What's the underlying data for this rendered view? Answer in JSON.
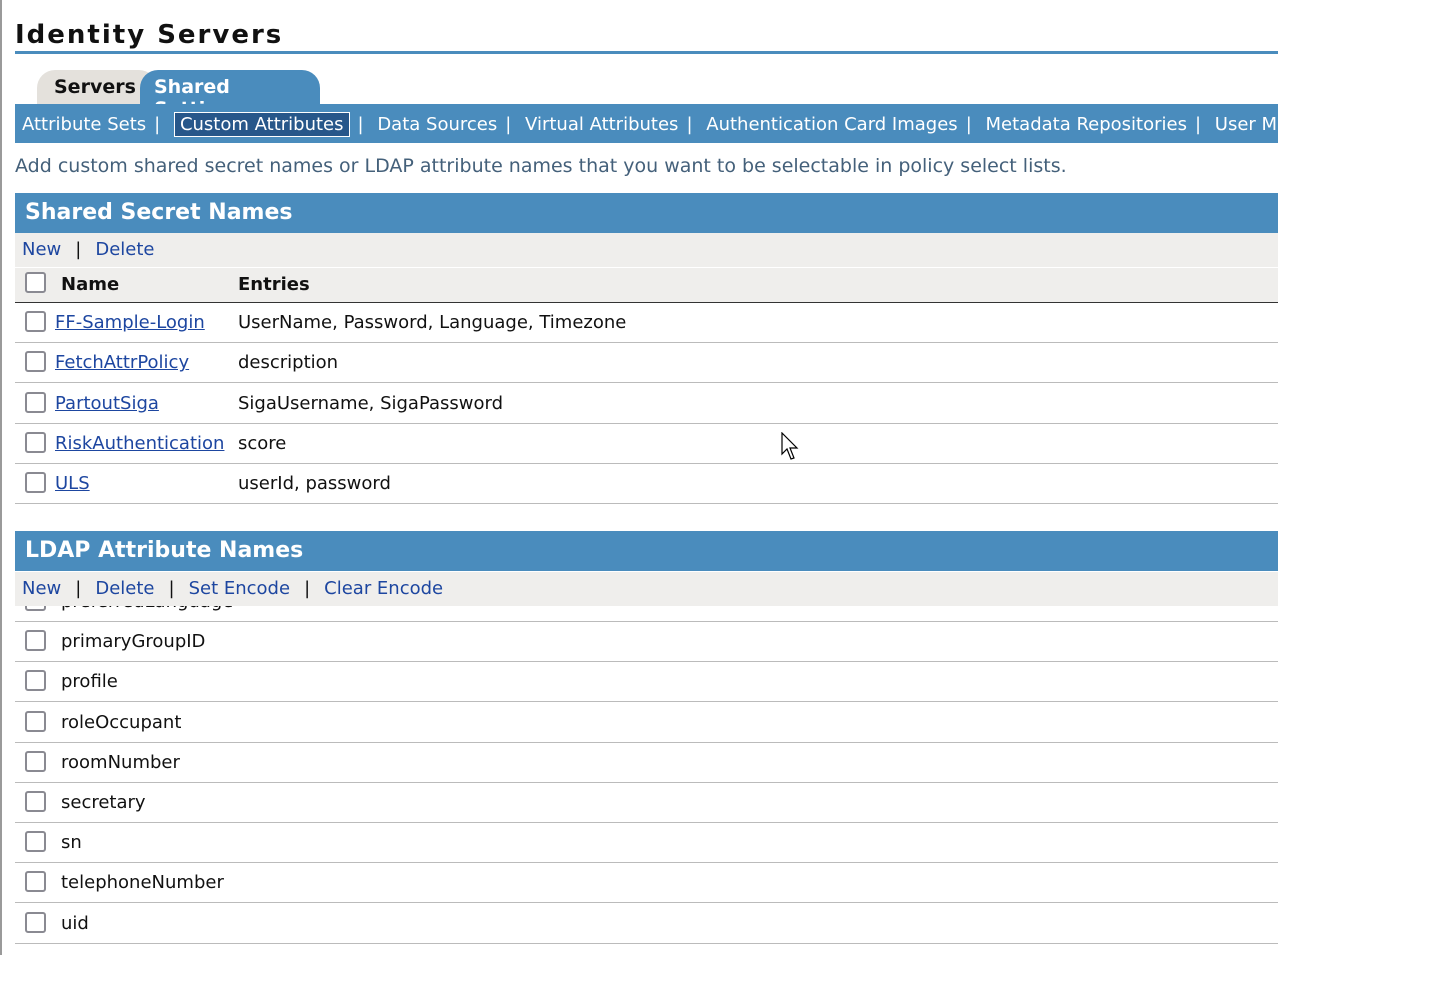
{
  "title": "Identity Servers",
  "tabs": [
    {
      "label": "Servers"
    },
    {
      "label": "Shared Settings",
      "active": true
    }
  ],
  "subnav": [
    "Attribute Sets",
    "Custom Attributes",
    "Data Sources",
    "Virtual Attributes",
    "Authentication Card Images",
    "Metadata Repositories",
    "User Matchi"
  ],
  "subnav_active": "Custom Attributes",
  "description": "Add custom shared secret names or LDAP attribute names that you want to be selectable in policy select lists.",
  "shared": {
    "title": "Shared Secret Names",
    "toolbar": {
      "new": "New",
      "delete": "Delete"
    },
    "columns": {
      "name": "Name",
      "entries": "Entries"
    },
    "rows": [
      {
        "name": "FF-Sample-Login",
        "entries": "UserName, Password, Language, Timezone"
      },
      {
        "name": "FetchAttrPolicy",
        "entries": "description"
      },
      {
        "name": "PartoutSiga",
        "entries": "SigaUsername, SigaPassword"
      },
      {
        "name": "RiskAuthentication",
        "entries": "score"
      },
      {
        "name": "ULS",
        "entries": "userId, password"
      }
    ]
  },
  "ldap": {
    "title": "LDAP Attribute Names",
    "toolbar": {
      "new": "New",
      "delete": "Delete",
      "set_encode": "Set Encode",
      "clear_encode": "Clear Encode"
    },
    "rows": [
      "preferredLanguage",
      "primaryGroupID",
      "profile",
      "roleOccupant",
      "roomNumber",
      "secretary",
      "sn",
      "telephoneNumber",
      "uid"
    ]
  },
  "colors": {
    "accent": "#4a8cbd",
    "link": "#1d46a0",
    "toolbar_bg": "#efeeec"
  }
}
